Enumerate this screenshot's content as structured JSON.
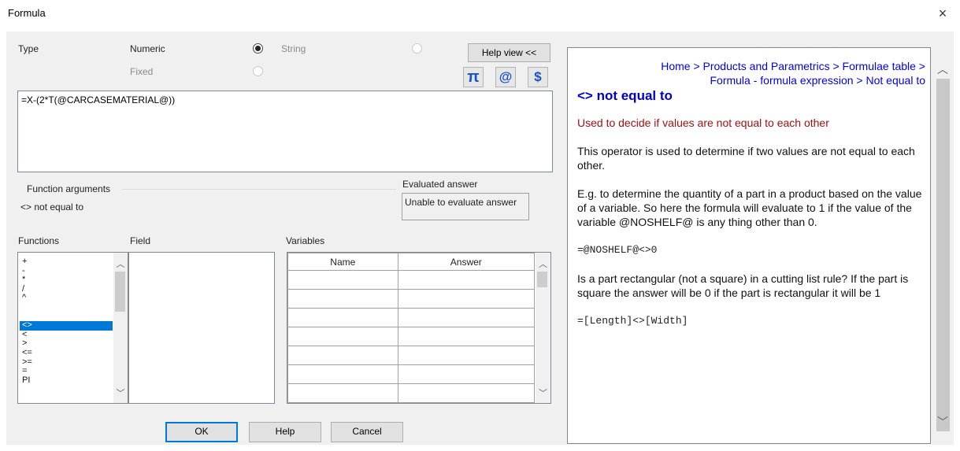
{
  "window": {
    "title": "Formula",
    "close_glyph": "×"
  },
  "type_section": {
    "label": "Type",
    "numeric_label": "Numeric",
    "string_label": "String",
    "fixed_label": "Fixed",
    "selected": "Numeric"
  },
  "toolbar": {
    "help_view_label": "Help view <<",
    "icons": [
      {
        "name": "pi-icon",
        "glyph": "π",
        "color": "#1a52c8"
      },
      {
        "name": "at-icon",
        "glyph": "@",
        "color": "#1a52c8"
      },
      {
        "name": "dollar-icon",
        "glyph": "$",
        "color": "#1a52c8"
      }
    ]
  },
  "formula": {
    "value": "=X-(2*T(@CARCASEMATERIAL@))"
  },
  "function_arguments": {
    "label": "Function arguments",
    "value": "<> not equal to"
  },
  "evaluated_answer": {
    "label": "Evaluated answer",
    "value": "Unable to evaluate answer"
  },
  "lists": {
    "functions_label": "Functions",
    "field_label": "Field",
    "variables_label": "Variables",
    "functions": [
      "+",
      "-",
      "*",
      "/",
      "^",
      "<>",
      "<",
      ">",
      "<=",
      ">=",
      "=",
      "PI"
    ],
    "selected_function": "<>",
    "variables_columns": [
      "Name",
      "Answer"
    ]
  },
  "buttons": {
    "ok": "OK",
    "help": "Help",
    "cancel": "Cancel"
  },
  "help": {
    "breadcrumb_line1": "Home > Products and Parametrics > Formulae table >",
    "breadcrumb_line2": "Formula - formula expression > Not equal to",
    "title": "<> not equal to",
    "summary": "Used to decide if values are not equal to each other",
    "para1": "This operator is used to determine if two values are not equal to each other.",
    "para2": "E.g. to determine the quantity of a part in a product based on the value of a variable. So here the formula will evaluate to 1 if the value of the variable @NOSHELF@ is any thing other than 0.",
    "code1": "=@NOSHELF@<>0",
    "para3": "Is a part rectangular (not a square) in a cutting list rule? If the part is square the answer will be 0 if the part is rectangular it will be 1",
    "code2": "=[Length]<>[Width]"
  }
}
